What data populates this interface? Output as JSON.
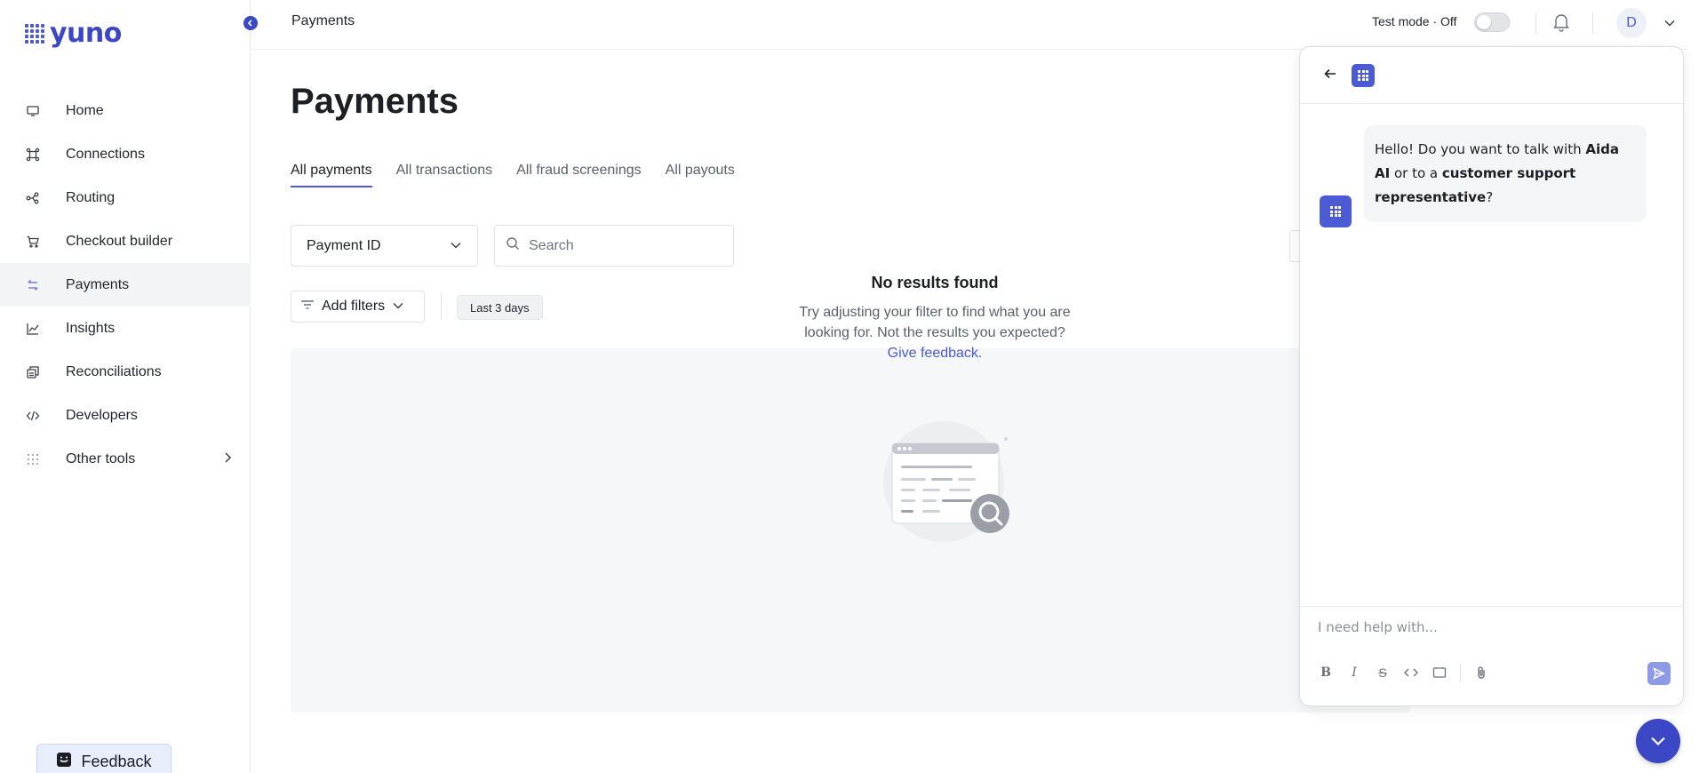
{
  "brand": {
    "name": "yuno",
    "accent": "#4c5bd4"
  },
  "sidebar": {
    "items": [
      {
        "label": "Home",
        "icon": "monitor-icon"
      },
      {
        "label": "Connections",
        "icon": "connections-icon"
      },
      {
        "label": "Routing",
        "icon": "routing-icon"
      },
      {
        "label": "Checkout builder",
        "icon": "cart-icon"
      },
      {
        "label": "Payments",
        "icon": "arrows-swap-icon",
        "active": true
      },
      {
        "label": "Insights",
        "icon": "chart-line-icon"
      },
      {
        "label": "Reconciliations",
        "icon": "reconcile-icon"
      },
      {
        "label": "Developers",
        "icon": "code-icon"
      },
      {
        "label": "Other tools",
        "icon": "grid-dots-icon"
      }
    ],
    "feedback_label": "Feedback"
  },
  "topbar": {
    "breadcrumb": "Payments",
    "test_mode_label": "Test mode · Off",
    "test_mode_on": false,
    "avatar_initial": "D"
  },
  "main": {
    "title": "Payments",
    "tabs": [
      {
        "label": "All payments",
        "active": true
      },
      {
        "label": "All transactions"
      },
      {
        "label": "All fraud screenings"
      },
      {
        "label": "All payouts"
      }
    ],
    "id_select": "Payment ID",
    "search_placeholder": "Search",
    "add_filters_label": "Add filters",
    "date_chip": "Last 3 days",
    "empty": {
      "title": "No results found",
      "line1": "Try adjusting your filter to find what you are",
      "line2": "looking for. Not the results you expected?",
      "link": "Give feedback."
    }
  },
  "chat": {
    "greeting_pre": "Hello! Do you want to talk with ",
    "greeting_b1": "Aida AI",
    "greeting_mid": " or to a ",
    "greeting_b2": "customer support representative",
    "greeting_post": "?",
    "input_placeholder": "I need help with..."
  }
}
